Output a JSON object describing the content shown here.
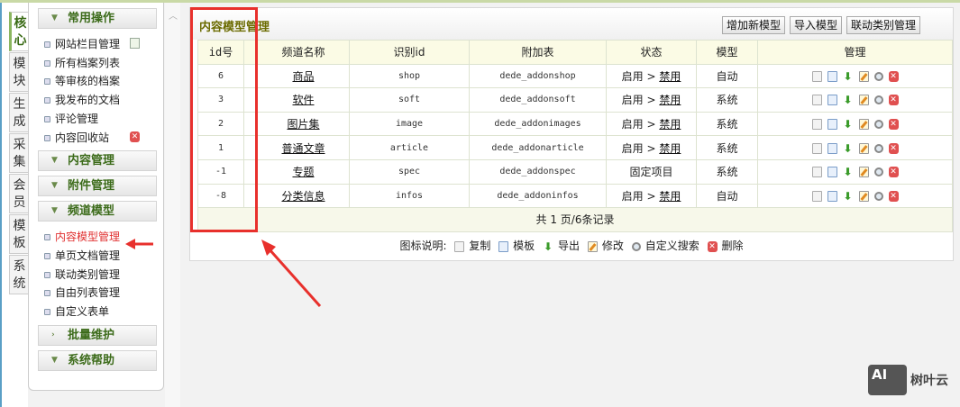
{
  "side_tabs": [
    "核心",
    "模块",
    "生成",
    "采集",
    "会员",
    "模板",
    "系统"
  ],
  "sidebar": {
    "groups": [
      {
        "label": "常用操作",
        "items": [
          "网站栏目管理",
          "所有档案列表",
          "等审核的档案",
          "我发布的文档",
          "评论管理",
          "内容回收站"
        ]
      },
      {
        "label": "内容管理"
      },
      {
        "label": "附件管理"
      },
      {
        "label": "频道模型",
        "items": [
          "内容模型管理",
          "单页文档管理",
          "联动类别管理",
          "自由列表管理",
          "自定义表单"
        ]
      },
      {
        "label": "批量维护"
      },
      {
        "label": "系统帮助"
      }
    ],
    "current": "内容模型管理"
  },
  "panel": {
    "title": "内容模型管理",
    "buttons": [
      "增加新模型",
      "导入模型",
      "联动类别管理"
    ],
    "columns": [
      "id号",
      "",
      "频道名称",
      "识别id",
      "附加表",
      "状态",
      "模型",
      "管理"
    ],
    "rows": [
      {
        "id": "6",
        "name": "商品",
        "nid": "shop",
        "table": "dede_addonshop",
        "status": "启用",
        "toggle": "禁用",
        "type": "自动"
      },
      {
        "id": "3",
        "name": "软件",
        "nid": "soft",
        "table": "dede_addonsoft",
        "status": "启用",
        "toggle": "禁用",
        "type": "系统"
      },
      {
        "id": "2",
        "name": "图片集",
        "nid": "image",
        "table": "dede_addonimages",
        "status": "启用",
        "toggle": "禁用",
        "type": "系统"
      },
      {
        "id": "1",
        "name": "普通文章",
        "nid": "article",
        "table": "dede_addonarticle",
        "status": "启用",
        "toggle": "禁用",
        "type": "系统"
      },
      {
        "id": "-1",
        "name": "专题",
        "nid": "spec",
        "table": "dede_addonspec",
        "status": "固定项目",
        "toggle": "",
        "type": "系统"
      },
      {
        "id": "-8",
        "name": "分类信息",
        "nid": "infos",
        "table": "dede_addoninfos",
        "status": "启用",
        "toggle": "禁用",
        "type": "自动"
      }
    ],
    "pager": "共 1 页/6条记录",
    "legend": {
      "label": "图标说明:",
      "copy": "复制",
      "template": "模板",
      "export": "导出",
      "edit": "修改",
      "search": "自定义搜索",
      "delete": "删除"
    }
  },
  "watermark": {
    "badge": "AI",
    "text": "树叶云"
  },
  "colors": {
    "annotation": "#e8302c",
    "current_item": "#e03030",
    "group_text": "#3c6b1a"
  }
}
